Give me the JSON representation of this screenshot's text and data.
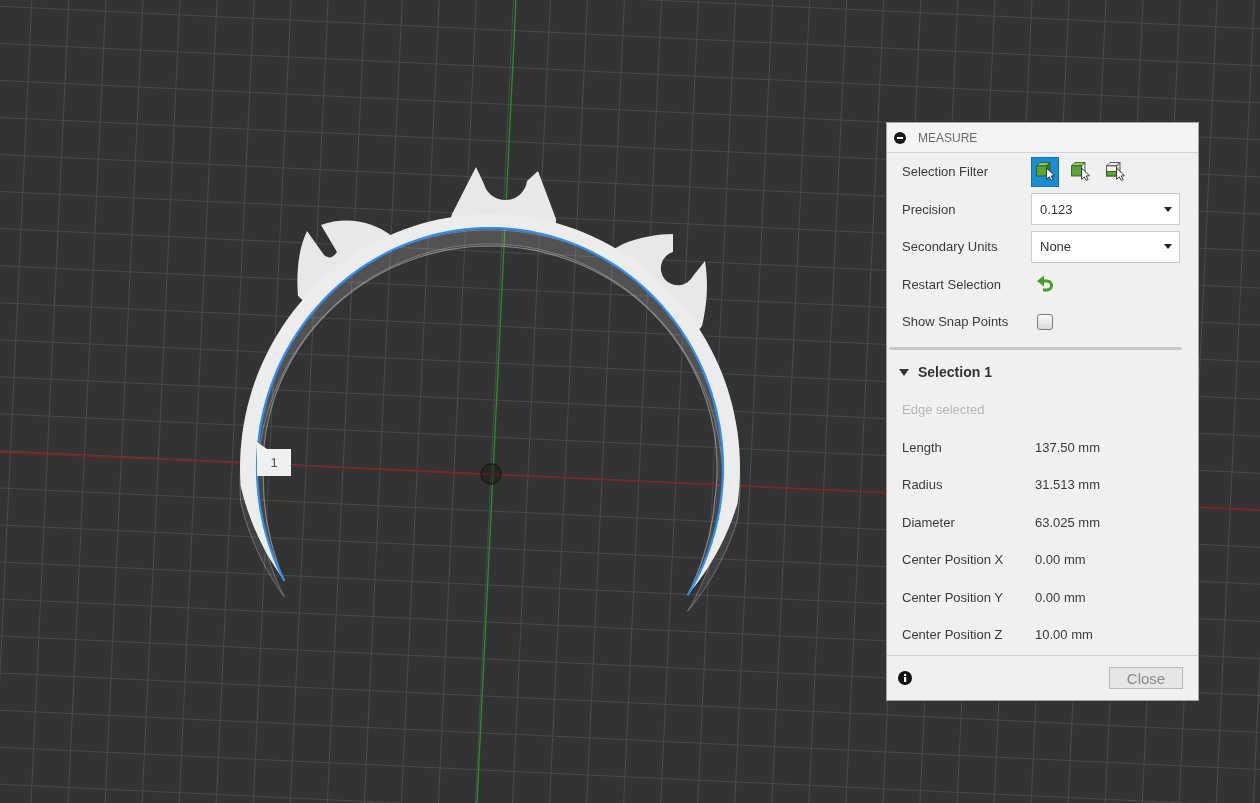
{
  "viewport": {
    "selection_label": "1"
  },
  "measure_panel": {
    "title": "MEASURE",
    "settings": [
      {
        "kind": "filter",
        "label": "Selection Filter",
        "options": [
          {
            "kind": "body",
            "selected": true
          },
          {
            "kind": "face",
            "selected": false
          },
          {
            "kind": "edge",
            "selected": false
          }
        ]
      },
      {
        "kind": "dropdown",
        "label": "Precision",
        "value": "0.123"
      },
      {
        "kind": "dropdown",
        "label": "Secondary Units",
        "value": "None"
      },
      {
        "kind": "action",
        "label": "Restart Selection"
      },
      {
        "kind": "checkbox",
        "label": "Show Snap Points",
        "checked": false
      }
    ],
    "selection": {
      "title": "Selection 1",
      "expanded": true,
      "status": "Edge selected",
      "results": [
        {
          "label": "Length",
          "value": "137.50 mm"
        },
        {
          "label": "Radius",
          "value": "31.513 mm"
        },
        {
          "label": "Diameter",
          "value": "63.025 mm"
        },
        {
          "label": "Center Position X",
          "value": "0.00 mm"
        },
        {
          "label": "Center Position Y",
          "value": "0.00 mm"
        },
        {
          "label": "Center Position Z",
          "value": "10.00 mm"
        }
      ]
    },
    "close_label": "Close"
  }
}
